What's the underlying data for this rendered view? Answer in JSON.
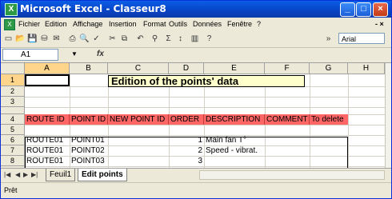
{
  "window": {
    "title": "Microsoft Excel - Classeur8"
  },
  "menu": [
    "Fichier",
    "Edition",
    "Affichage",
    "Insertion",
    "Format",
    "Outils",
    "Données",
    "Fenêtre",
    "?"
  ],
  "font_name": "Arial",
  "name_box": "A1",
  "formula_label": "fx",
  "columns": [
    "A",
    "B",
    "C",
    "D",
    "E",
    "F",
    "G",
    "H"
  ],
  "rows": [
    "1",
    "2",
    "3",
    "4",
    "5",
    "6",
    "7",
    "8",
    "9"
  ],
  "sheet_title": "Edition of the points' data",
  "header_cells": [
    "ROUTE ID",
    "POINT ID",
    "NEW POINT ID",
    "ORDER",
    "DESCRIPTION",
    "COMMENT",
    "To delete"
  ],
  "data_rows": [
    {
      "route_id": "ROUTE01",
      "point_id": "POINT01",
      "order": "1",
      "description": "Main fan T°"
    },
    {
      "route_id": "ROUTE01",
      "point_id": "POINT02",
      "order": "2",
      "description": "Speed - vibrat."
    },
    {
      "route_id": "ROUTE01",
      "point_id": "POINT03",
      "order": "3",
      "description": ""
    }
  ],
  "sheet_tabs": [
    "Feuil1",
    "Edit points"
  ],
  "active_tab": "Edit points",
  "status_text": "Prêt",
  "colors": {
    "header_fill": "#ff6666",
    "title_fill": "#ffffcc",
    "titlebar": "#0a5ee6"
  }
}
